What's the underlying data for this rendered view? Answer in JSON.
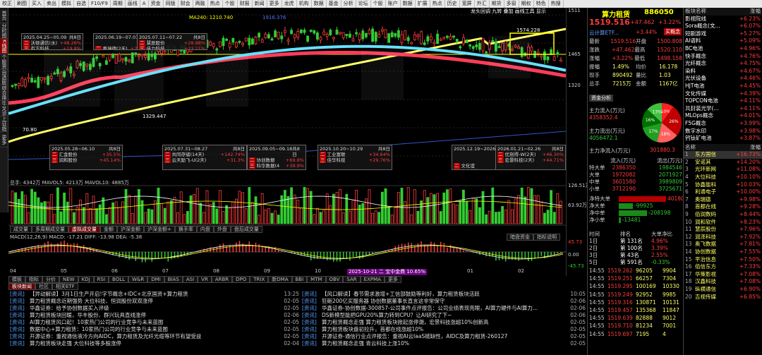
{
  "toolbar": {
    "items": [
      "校正",
      "刷图",
      "买入",
      "卖出",
      "模拟",
      "自选",
      "F10/F9",
      "周期",
      "画线",
      "A",
      "资金",
      "同版",
      "财会",
      "两融",
      "热点",
      "个股",
      "财报",
      "新闻",
      "更多",
      "龙虎",
      "机构",
      "数据",
      "基金",
      "分析",
      "论坛",
      "个股",
      "账户",
      "数据",
      "扩展",
      "热点",
      "历史",
      "宽屏",
      "外汇",
      "期货",
      "多窗",
      "期权",
      "特色",
      "热搜"
    ]
  },
  "leftnav": [
    {
      "label": "首页",
      "active": false
    },
    {
      "label": "分时图",
      "active": false
    },
    {
      "label": "K线图",
      "active": true
    },
    {
      "label": "个股资料",
      "active": false
    },
    {
      "label": "自选股",
      "active": false
    },
    {
      "label": "综合排名",
      "active": false
    },
    {
      "label": "牛叉诊股",
      "active": false
    },
    {
      "label": "上证指数",
      "active": false
    },
    {
      "label": "更多",
      "active": false
    }
  ],
  "chart_header": {
    "ma_info": "MA240: 1210.740",
    "ma_extra": "1916.376",
    "right_tabs": [
      "龙头回调",
      "九转",
      "叠加",
      "画线工具",
      "显示"
    ],
    "high_label": "1574.228",
    "low_label": "1329.447",
    "left_low": "70.80",
    "stock_tag_left": "AAAAA"
  },
  "price_axis": [
    "1511",
    "1465",
    "1320",
    "1270",
    "1100",
    "1000",
    "900",
    "800",
    "700",
    "600",
    "500",
    "400",
    "300",
    "200"
  ],
  "popups": [
    {
      "date": "2025.04.25~05.09",
      "days": "共8日",
      "rows": [
        [
          "二",
          "沃顿通信(水)",
          "+48.26%"
        ],
        [
          "三",
          "有方科技",
          "+19.8%"
        ]
      ]
    },
    {
      "date": "2025.06.19~07.01",
      "days": "共8日",
      "rows": [
        [
          "二",
          "奥瑞德(2天)",
          "+23.4%"
        ],
        [
          "三",
          "德明利",
          "+30.7%"
        ]
      ]
    },
    {
      "date": "2025.07.11~07.22",
      "days": "共8日",
      "rows": [
        [
          "二",
          "慧辰股份",
          "+28.98%"
        ],
        [
          "三",
          "佳力科技",
          "+23.21%"
        ]
      ]
    },
    {
      "date": "2025.05.28~06.10",
      "days": "共8日",
      "rows": [
        [
          "二",
          "汇金股份",
          "+35.5%"
        ],
        [
          "三",
          "润和股份",
          "+45.14%"
        ]
      ]
    },
    {
      "date": "2025.07.31~08.27",
      "days": "共8日",
      "rows": [
        [
          "二",
          "共同存储(14天)",
          "+142.74%"
        ],
        [
          "三",
          "云天励飞-U(2天)",
          "+31.3%"
        ]
      ]
    },
    {
      "date": "2025.09.05~09.18",
      "days": "共8日",
      "rows": [
        [
          "二",
          "协创数据",
          "+69.8%"
        ],
        [
          "三",
          "科华数据(4天)",
          "+39.9%"
        ]
      ]
    },
    {
      "date": "2025.10.20~10.29",
      "days": "共8日",
      "rows": [
        [
          "二",
          "工业富联",
          "+34.64%"
        ],
        [
          "三",
          "佳华科技",
          "+29.76%"
        ]
      ]
    },
    {
      "date": "2025.12.19~2026.01.16",
      "days": "共8日",
      "rows": [
        [
          "二",
          "文化谊",
          "+36.5%"
        ],
        [
          "三",
          "直真科技",
          "+4.9%"
        ]
      ]
    },
    {
      "date": "2026.01.21~02.26",
      "days": "共8日",
      "rows": [
        [
          "二",
          "优刻得-W(2天)",
          "+46.30%"
        ],
        [
          "三",
          "宏景科技(2天)",
          "+44.71%"
        ]
      ]
    }
  ],
  "volume": {
    "header": "总手: 4342万  MAVOL5: 4213万  MAVOL10: 4885万",
    "axis_top": "126.51万",
    "axis_mid": "63.92万",
    "tabs": [
      "成交量",
      "多周期成交量",
      "虚拟成交量",
      "金额",
      "沪深金额",
      "沪深金额+",
      "换手率",
      "内盘",
      "外盘",
      "盘后成交量"
    ]
  },
  "macd": {
    "header": "MACD(12,26,9)  MACD: -17.21  DIFF: -13.98  DEA: -5.38",
    "axis_top": "45.73",
    "axis_zero": "0.00",
    "axis_bot": "-45.73",
    "right_tabs": [
      "暗盘资金",
      "指标说明"
    ]
  },
  "x_axis": [
    "04",
    "05",
    "06",
    "07",
    "08",
    "09",
    "10",
    "11",
    "12",
    "01",
    "02"
  ],
  "x_highlight": "2025-10-21 二 宝中金鼎 10.65%",
  "indicators": [
    "分价",
    "NEW",
    "KDJ",
    "RSI",
    "BOLL",
    "W&R",
    "DMI",
    "BIAS",
    "ASI",
    "VR",
    "ARBR",
    "DPO",
    "TRIX",
    "新DMA",
    "BBI",
    "MTM",
    "OBV",
    "SAR",
    "EXPMA",
    "更多"
  ],
  "indicator_prefix": [
    "模板",
    "指标"
  ],
  "quote": {
    "name": "算力租赁",
    "code": "886050",
    "price": "1519.516",
    "change": "+47.462",
    "pct": "+3.22%",
    "cloud_tag": "云计算ETF...",
    "cloud_pct": "+3.44%",
    "buy_btn": "买概念",
    "rows": [
      [
        "最新",
        "1519.516",
        "开盘",
        "1500.808"
      ],
      [
        "涨跌",
        "+47.462",
        "最高",
        "1520.110"
      ],
      [
        "涨幅",
        "+3.22%",
        "最低",
        "1498.158"
      ],
      [
        "振幅",
        "1.49%",
        "均价",
        "16.178"
      ],
      [
        "现手",
        "890492",
        "量比",
        "1.03"
      ],
      [
        "总手",
        "7215万",
        "金额",
        "1167亿"
      ]
    ],
    "fund_tab": "资金分析",
    "main_in_label": "主力流入(万元)",
    "main_in": "4358352.4",
    "main_out_label": "主力流出(万元)",
    "main_out": "4056472.1",
    "main_net_label": "主力净流入(万元)",
    "main_net": "301880.3",
    "pie": [
      {
        "label": "10%",
        "value": 10,
        "color": "#ff2020"
      },
      {
        "label": "26%",
        "value": 26,
        "color": "#c00000"
      },
      {
        "label": "18%",
        "value": 18,
        "color": "#ff6060"
      },
      {
        "label": "17%",
        "value": 17,
        "color": "#20a020"
      },
      {
        "label": "16%",
        "value": 16,
        "color": "#007000"
      },
      {
        "label": "13%",
        "value": 13,
        "color": "#40c040"
      }
    ],
    "flow_header": [
      "",
      "流入(万元)",
      "",
      "流出(万元)"
    ],
    "flow_rows": [
      [
        "特大单",
        "2386350",
        "",
        "1984546"
      ],
      [
        "大单",
        "1972082",
        "",
        "2071927"
      ],
      [
        "中单",
        "3601580",
        "",
        "3989809"
      ],
      [
        "小单",
        "3712190",
        "",
        "3725671"
      ]
    ],
    "net_rows": [
      [
        "净特大单",
        "401805"
      ],
      [
        "净大单",
        "-99925"
      ],
      [
        "净中单",
        "-208198"
      ],
      [
        "净小单",
        "-13481"
      ]
    ],
    "period_header": [
      "时间",
      "排名",
      "大单净比"
    ],
    "period_rows": [
      [
        "1日",
        "第 131名",
        "4.96%"
      ],
      [
        "2日",
        "第 100名",
        "3.39%"
      ],
      [
        "3日",
        "第 43名",
        "2.55%"
      ],
      [
        "5日",
        "第 591名",
        "-0.33%"
      ]
    ],
    "ticks": [
      [
        "14:55",
        "1519.262",
        "96205",
        "9904"
      ],
      [
        "14:55",
        "1519.251",
        "66257",
        "7304"
      ],
      [
        "14:55",
        "1519.295",
        "100169",
        "10330"
      ],
      [
        "14:55",
        "1519.249",
        "92952",
        "9985"
      ],
      [
        "14:55",
        "1519.316",
        "130871",
        "10131"
      ],
      [
        "14:55",
        "1519.457",
        "135368",
        "11847"
      ],
      [
        "14:55",
        "1519.639",
        "82888",
        "9012"
      ],
      [
        "14:55",
        "1519.710",
        "81234",
        "7001"
      ],
      [
        "14:55",
        "1519.697",
        "7195",
        "4"
      ]
    ]
  },
  "sectors": {
    "header": [
      "板块名称",
      "涨幅"
    ],
    "rows": [
      [
        "影视院线",
        "+6.23%"
      ],
      [
        "Sora概念(文...",
        "+6.07%"
      ],
      [
        "短剧游戏",
        "+5.27%"
      ],
      [
        "AI语料",
        "+5.09%"
      ],
      [
        "BC电池",
        "+4.96%"
      ],
      [
        "快手概念",
        "+4.76%"
      ],
      [
        "光纤概念",
        "+4.75%"
      ],
      [
        "染料",
        "+4.67%"
      ],
      [
        "光伏设备",
        "+4.46%"
      ],
      [
        "HJT电池",
        "+4.45%"
      ],
      [
        "文化传媒",
        "+4.39%"
      ],
      [
        "TOPCON电池",
        "+4.11%"
      ],
      [
        "共封装光学(...",
        "+4.11%"
      ],
      [
        "MLOps概念",
        "+4.01%"
      ],
      [
        "F5G概念",
        "+3.99%"
      ],
      [
        "数字水印",
        "+3.98%"
      ],
      [
        "钙钛矿电池",
        "+3.87%"
      ]
    ],
    "stock_header": [
      "名称",
      "涨幅"
    ],
    "stocks": [
      [
        "1",
        "东方国信",
        "+16.73%"
      ],
      [
        "2",
        "安诺其",
        "+14.20%"
      ],
      [
        "3",
        "光环新网",
        "+11.08%"
      ],
      [
        "4",
        "大位科技",
        "+10.10%"
      ],
      [
        "5",
        "协鑫能科",
        "+10.03%"
      ],
      [
        "6",
        "利通电子",
        "+10.00%"
      ],
      [
        "7",
        "奥瑞德",
        "+9.98%"
      ],
      [
        "8",
        "首都在线",
        "+9.28%"
      ],
      [
        "9",
        "佰润数码",
        "+8.44%"
      ],
      [
        "10",
        "润和软件",
        "+8.23%"
      ],
      [
        "11",
        "慧辰股份",
        "+7.96%"
      ],
      [
        "12",
        "润泽科技",
        "+7.92%"
      ],
      [
        "13",
        "奥飞数据",
        "+7.81%"
      ],
      [
        "14",
        "协创数据",
        "+7.55%"
      ],
      [
        "15",
        "平治信息",
        "+7.50%"
      ],
      [
        "16",
        "佰信东方",
        "+7.33%"
      ],
      [
        "17",
        "华策影视",
        "+7.08%"
      ],
      [
        "18",
        "汉鑫科技",
        "+7.08%"
      ],
      [
        "19",
        "纵横通信",
        "+6.90%"
      ],
      [
        "20",
        "吉视传媒",
        "+6.85%"
      ]
    ]
  },
  "news_tabs": [
    "板块新闻",
    "社区",
    "相关ETF"
  ],
  "news_left": [
    [
      "[资讯]",
      "【异动解读】3月1日生产开启!字节概念+IDC+北京国资+算力租赁",
      "13:25"
    ],
    [
      "[资讯]",
      "算力租赁概念近期强势 大位科技、恒润股份双双涨停",
      "02-05"
    ],
    [
      "[资讯]",
      "华鑫证券：给予协创数据买入评级",
      "02-05"
    ],
    [
      "[资讯]",
      "算力租赁板块回暖，华丰股份、群兴玩具直线涨停",
      "02-06"
    ],
    [
      "[资讯]",
      "AI算力租赁风口起！10家热门公司的行业竞争与未来蓝图",
      "02-05"
    ],
    [
      "[资讯]",
      "数据中心+算力租赁：10家热门公司的行业竞争与未来蓝图",
      "02-05"
    ],
    [
      "[资讯]",
      "开源证券：重视通信液冷方向AIDC，算力租赁及光纤光缆等环节有望受益",
      "02-05"
    ],
    [
      "[资讯]",
      "算力租赁板块走强 大位科技等多股涨停",
      "02-04"
    ]
  ],
  "news_right": [
    [
      "[资讯]",
      "【风口解读】春节需求激增+工信部鼓励等利好，算力租赁板块活跃",
      "10:05"
    ],
    [
      "[资讯]",
      "狂砸200亿买服务器 协创数据董事长直言这非常保守",
      "02-06"
    ],
    [
      "[资讯]",
      "华鑫证券-协创数据-300857-公司事件点评报告：公司业绩表现亮眼，AI算力硬件与AI算力...",
      "02-06"
    ],
    [
      "[资讯]",
      "DS新模型能把GPU20%算力转到CPU？让AI研究了下~",
      "02-06"
    ],
    [
      "[资讯]",
      "算力租赁概念走强 算力租赁板块掀起涨停潮，宏景科技涨超10%创新高",
      "02-05"
    ],
    [
      "[资讯]",
      "算力租赁板块盘初拉升，首都在线涨超10%",
      "02-05"
    ],
    [
      "[资讯]",
      "开源证券-通信行业点评报告：重视AI云IaaS链缺性，AIDC及算力租赁-260127",
      "02-05"
    ],
    [
      "[资讯]",
      "算力租赁概念走强 青云科技上涨10%",
      "02-05"
    ]
  ],
  "colors": {
    "up": "#ff3c3c",
    "down": "#33cc33",
    "ma_white": "#ffffff",
    "ma_yellow": "#ffff66",
    "ma_red": "#ff3c5a",
    "ma_cyan": "#66e0ff"
  }
}
